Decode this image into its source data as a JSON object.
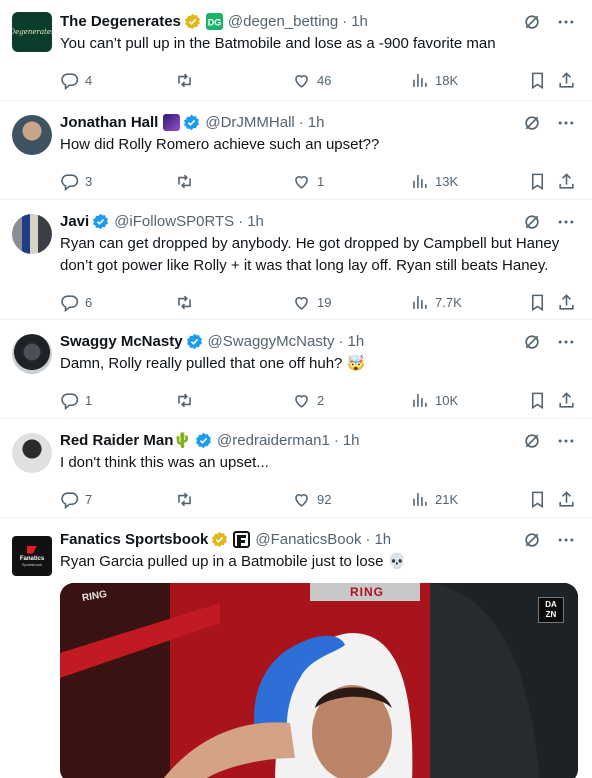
{
  "tweets": [
    {
      "name": "The Degenerates",
      "handle": "@degen_betting",
      "time": "1h",
      "text": "You can’t pull up in the Batmobile and lose as a -900 favorite man",
      "replies": "4",
      "reposts": "",
      "likes": "46",
      "views": "18K",
      "avatar_color": "#0b3d2a"
    },
    {
      "name": "Jonathan Hall",
      "handle": "@DrJMMHall",
      "time": "1h",
      "text": "How did Rolly Romero achieve such an upset??",
      "replies": "3",
      "reposts": "",
      "likes": "1",
      "views": "13K",
      "avatar_color": "#5a6b78"
    },
    {
      "name": "Javi",
      "handle": "@iFollowSP0RTS",
      "time": "1h",
      "text": "Ryan can get dropped by anybody. He got dropped by Campbell but Haney don’t got power like Rolly + it was that long lay off. Ryan still beats Haney.",
      "replies": "6",
      "reposts": "",
      "likes": "19",
      "views": "7.7K",
      "avatar_color": "#7a7f86"
    },
    {
      "name": "Swaggy McNasty",
      "handle": "@SwaggyMcNasty",
      "time": "1h",
      "text": "Damn, Rolly really pulled that one off huh? 🤯",
      "replies": "1",
      "reposts": "",
      "likes": "2",
      "views": "10K",
      "avatar_color": "#2c2f33"
    },
    {
      "name": "Red Raider Man🌵",
      "handle": "@redraiderman1",
      "time": "1h",
      "text": "I don't think this was an upset...",
      "replies": "7",
      "reposts": "",
      "likes": "92",
      "views": "21K",
      "avatar_color": "#1b1b1b"
    },
    {
      "name": "Fanatics Sportsbook",
      "handle": "@FanaticsBook",
      "time": "1h",
      "text": "Ryan Garcia pulled up in a Batmobile just to lose 💀",
      "avatar_color": "#111111",
      "avatar_text": "Fanatics",
      "avatar_subtext": "Sportsbook"
    }
  ],
  "separator": "·",
  "degen_avatar_text": "Degenerates",
  "media": {
    "ring_text_1": "RING",
    "ring_text_2": "RING",
    "dazn_1": "DA",
    "dazn_2": "ZN"
  },
  "colors": {
    "verified_gold": "#e2b719",
    "verified_blue": "#1d9bf0",
    "secondary_text": "#536471",
    "divider": "#eff3f4"
  },
  "icons": [
    "reply-icon",
    "repost-icon",
    "like-icon",
    "views-icon",
    "bookmark-icon",
    "share-icon",
    "grok-icon",
    "more-icon"
  ]
}
